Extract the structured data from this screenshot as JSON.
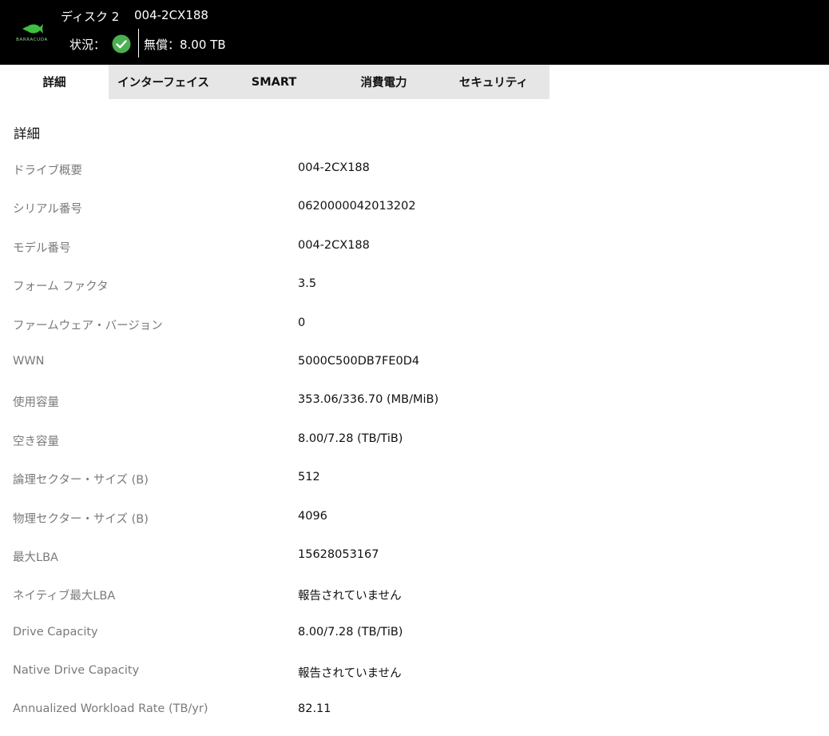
{
  "header": {
    "logo_text": "BARRACUDA",
    "disk_name": "ディスク 2",
    "disk_model": "004-2CX188",
    "status_label": "状況：",
    "status_color": "#4caf50",
    "capacity": "無償：8.00 TB"
  },
  "tabs": [
    {
      "label": "詳細",
      "active": true
    },
    {
      "label": "インターフェイス",
      "active": false
    },
    {
      "label": "SMART",
      "active": false
    },
    {
      "label": "消費電力",
      "active": false
    },
    {
      "label": "セキュリティ",
      "active": false
    }
  ],
  "section_title": "詳細",
  "details": [
    {
      "label": "ドライブ概要",
      "value": "004-2CX188"
    },
    {
      "label": "シリアル番号",
      "value": "0620000042013202"
    },
    {
      "label": "モデル番号",
      "value": "004-2CX188"
    },
    {
      "label": "フォーム ファクタ",
      "value": "3.5"
    },
    {
      "label": "ファームウェア・バージョン",
      "value": "0"
    },
    {
      "label": "WWN",
      "value": "5000C500DB7FE0D4"
    },
    {
      "label": "使用容量",
      "value": "353.06/336.70 (MB/MiB)"
    },
    {
      "label": "空き容量",
      "value": "8.00/7.28 (TB/TiB)"
    },
    {
      "label": "論理セクター・サイズ (B)",
      "value": "512"
    },
    {
      "label": "物理セクター・サイズ (B)",
      "value": "4096"
    },
    {
      "label": "最大LBA",
      "value": "15628053167"
    },
    {
      "label": "ネイティブ最大LBA",
      "value": "報告されていません"
    },
    {
      "label": "Drive Capacity",
      "value": "8.00/7.28 (TB/TiB)"
    },
    {
      "label": "Native Drive Capacity",
      "value": "報告されていません"
    },
    {
      "label": "Annualized Workload Rate (TB/yr)",
      "value": "82.11"
    }
  ]
}
